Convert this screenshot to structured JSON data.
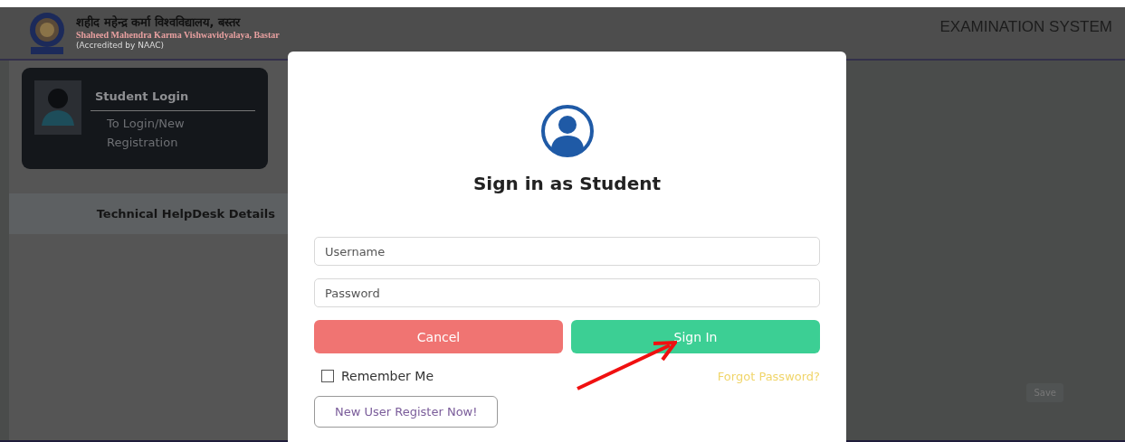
{
  "header": {
    "name_hindi": "शहीद महेन्द्र कर्मा विश्वविद्यालय, बस्तर",
    "name_english": "Shaheed Mahendra Karma Vishwavidyalaya, Bastar",
    "accreditation": "(Accredited by NAAC)",
    "system_title": "EXAMINATION SYSTEM"
  },
  "sidebar": {
    "card": {
      "title": "Student Login",
      "subtitle": "To Login/New Registration"
    },
    "helpdesk": "Technical HelpDesk Details"
  },
  "background_button": "Save",
  "modal": {
    "title": "Sign in as Student",
    "fields": [
      {
        "placeholder": "Username"
      },
      {
        "placeholder": "Password"
      }
    ],
    "buttons": [
      {
        "label": "Cancel",
        "kind": "cancel"
      },
      {
        "label": "Sign In",
        "kind": "submit"
      }
    ],
    "remember": {
      "label": "Remember Me",
      "checked": false
    },
    "forgot": "Forgot Password?",
    "register": "New User Register Now!"
  }
}
